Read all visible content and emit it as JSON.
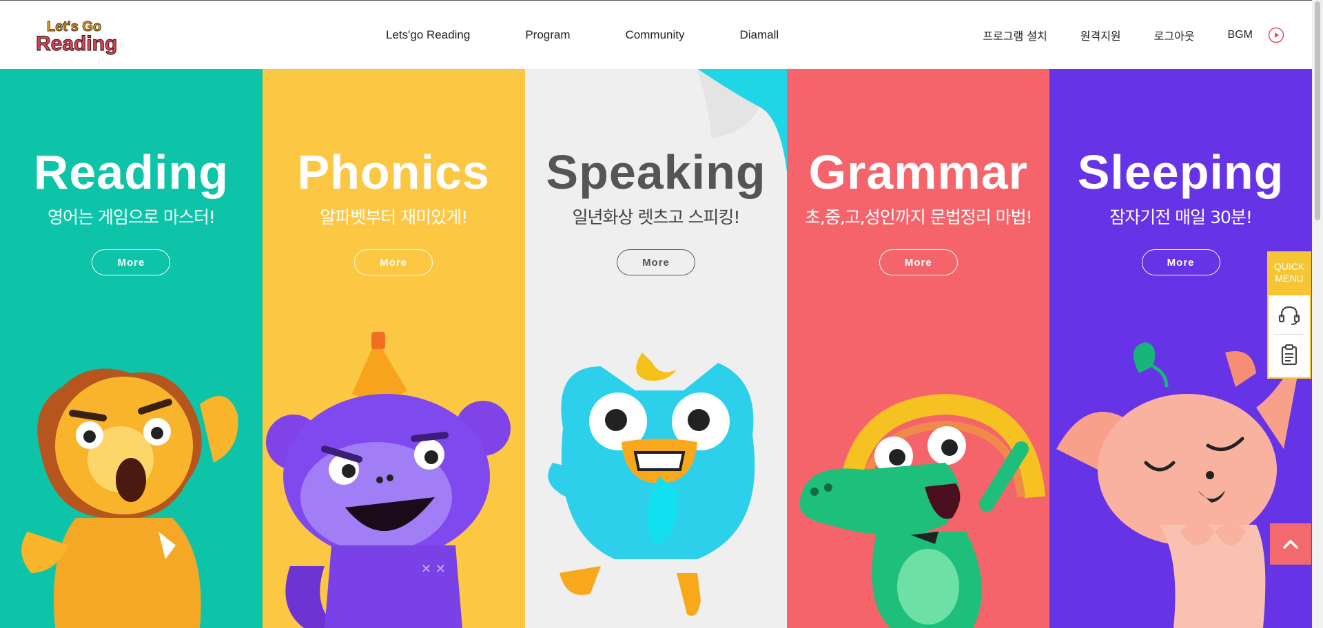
{
  "header": {
    "logo_text_top": "Let's Go",
    "logo_text_bottom": "Reading",
    "nav": [
      {
        "label": "Lets'go Reading"
      },
      {
        "label": "Program"
      },
      {
        "label": "Community"
      },
      {
        "label": "Diamall"
      }
    ],
    "util": {
      "install": "프로그램 설치",
      "remote": "원격지원",
      "logout": "로그아웃",
      "bgm": "BGM"
    }
  },
  "panels": [
    {
      "title": "Reading",
      "subtitle": "영어는 게임으로 마스터!",
      "more": "More",
      "color": "#0ec4a8"
    },
    {
      "title": "Phonics",
      "subtitle": "알파벳부터 재미있게!",
      "more": "More",
      "color": "#fcc844"
    },
    {
      "title": "Speaking",
      "subtitle": "일년화상 렛츠고 스피킹!",
      "more": "More",
      "color": "#efefef"
    },
    {
      "title": "Grammar",
      "subtitle": "초,중,고,성인까지 문법정리 마법!",
      "more": "More",
      "color": "#f4646a"
    },
    {
      "title": "Sleeping",
      "subtitle": "잠자기전 매일 30분!",
      "more": "More",
      "color": "#6633e6"
    }
  ],
  "quick_menu": {
    "label_line1": "QUICK",
    "label_line2": "MENU",
    "items": [
      {
        "icon": "headset-icon"
      },
      {
        "icon": "clipboard-icon"
      }
    ]
  },
  "to_top": {
    "icon": "chevron-up-icon"
  }
}
